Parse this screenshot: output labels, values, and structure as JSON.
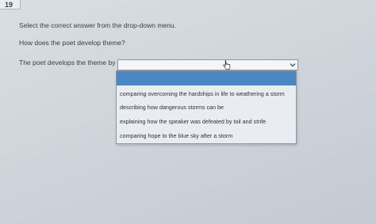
{
  "header": {
    "question_number": "19"
  },
  "prompt": {
    "instruction": "Select the correct answer from the drop-down menu.",
    "question": "How does the poet develop theme?",
    "stem": "The poet develops the theme by"
  },
  "dropdown": {
    "selected_value": "",
    "options": [
      "comparing overcoming the hardships in life to weathering a storm",
      "describing how dangerous storms can be",
      "explaining how the speaker was defeated by toil and strife",
      "comparing hope to the blue sky after a storm"
    ],
    "highlight_color": "#4a86bf"
  }
}
